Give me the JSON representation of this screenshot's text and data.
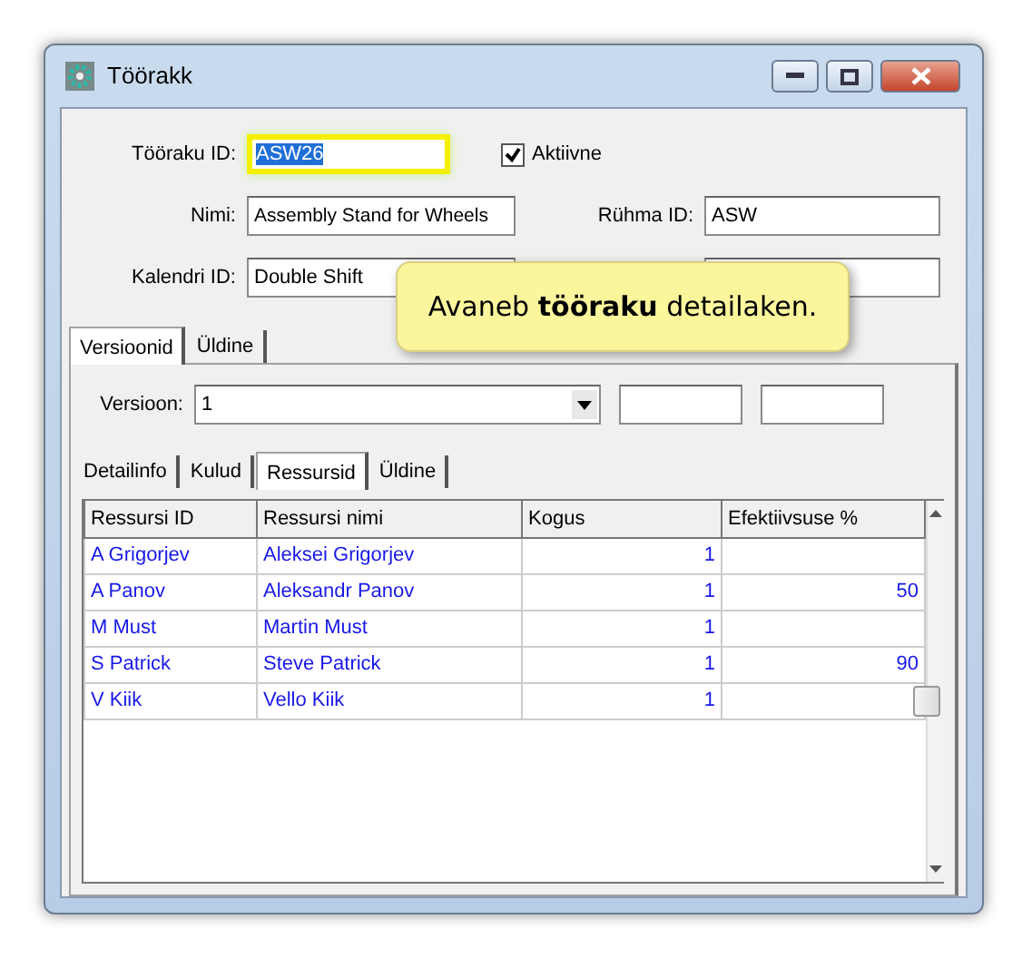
{
  "window": {
    "title": "Töörakk"
  },
  "fields": {
    "id": {
      "label": "Tööraku ID:",
      "value": "ASW26",
      "focused": true
    },
    "active": {
      "label": "Aktiivne",
      "checked": true
    },
    "name": {
      "label": "Nimi:",
      "value": "Assembly Stand for Wheels"
    },
    "group": {
      "label": "Rühma ID:",
      "value": "ASW"
    },
    "calendar": {
      "label": "Kalendri ID:",
      "value": "Double Shift"
    }
  },
  "tabs": [
    {
      "label": "Versioonid",
      "selected": true
    },
    {
      "label": "Üldine",
      "selected": false
    }
  ],
  "version": {
    "label": "Versioon:",
    "value": "1"
  },
  "subtabs": [
    {
      "label": "Detailinfo",
      "selected": false
    },
    {
      "label": "Kulud",
      "selected": false
    },
    {
      "label": "Ressursid",
      "selected": true
    },
    {
      "label": "Üldine",
      "selected": false
    }
  ],
  "table": {
    "columns": [
      "Ressursi ID",
      "Ressursi nimi",
      "Kogus",
      "Efektiivsuse %"
    ],
    "rows": [
      [
        "A Grigorjev",
        "Aleksei Grigorjev",
        "1",
        ""
      ],
      [
        "A Panov",
        "Aleksandr Panov",
        "1",
        "50"
      ],
      [
        "M Must",
        "Martin Must",
        "1",
        ""
      ],
      [
        "S Patrick",
        "Steve Patrick",
        "1",
        "90"
      ],
      [
        "V Kiik",
        "Vello Kiik",
        "1",
        ""
      ]
    ]
  },
  "callout": {
    "text": "Avaneb **tööraku** detailaken."
  }
}
